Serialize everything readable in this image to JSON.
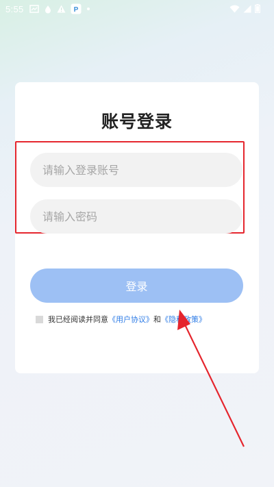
{
  "status_bar": {
    "time": "5:55",
    "left_icons": [
      "screenshot-icon",
      "drip-icon",
      "warning-icon",
      "app-notification-icon",
      "dot-icon"
    ],
    "right_icons": [
      "wifi-icon",
      "signal-icon",
      "battery-icon"
    ]
  },
  "login": {
    "title": "账号登录",
    "account_placeholder": "请输入登录账号",
    "password_placeholder": "请输入密码",
    "submit_label": "登录",
    "agreement": {
      "prefix": "我已经阅读并同意",
      "user_agreement": "《用户协议》",
      "conjunction": "和",
      "privacy_policy": "《隐私政策》"
    }
  },
  "colors": {
    "title": "#222222",
    "input_bg": "#f2f2f2",
    "button_bg": "#9dc0f4",
    "link": "#2e7ce6",
    "annotation_red": "#e5252d"
  }
}
